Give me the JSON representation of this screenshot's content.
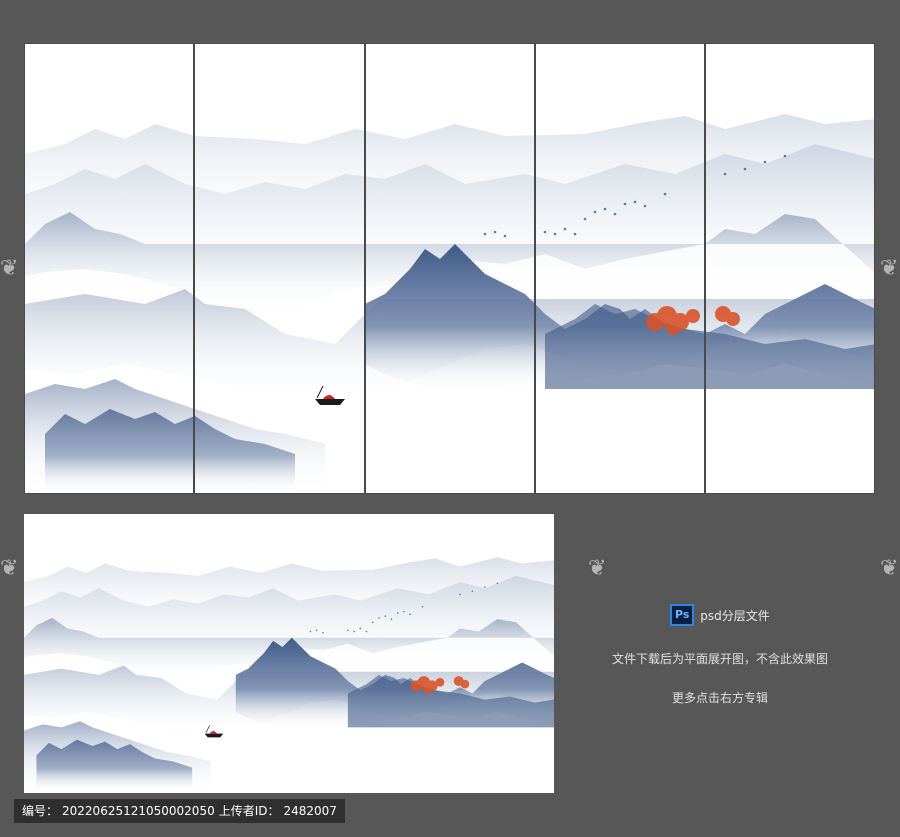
{
  "info": {
    "ps_badge": "Ps",
    "psd_label": "psd分层文件",
    "line1": "文件下载后为平面展开图，不含此效果图",
    "line2": "更多点击右方专辑"
  },
  "footer": {
    "id_label": "编号：",
    "id_value": "20220625121050002050",
    "uploader_label": "上传者ID：",
    "uploader_value": "2482007"
  },
  "colors": {
    "background": "#575757",
    "mountain_dark": "#3f5a87",
    "mountain_mid": "#8a9bb8",
    "mountain_light": "#c9d2e0",
    "tree": "#d9542a"
  }
}
